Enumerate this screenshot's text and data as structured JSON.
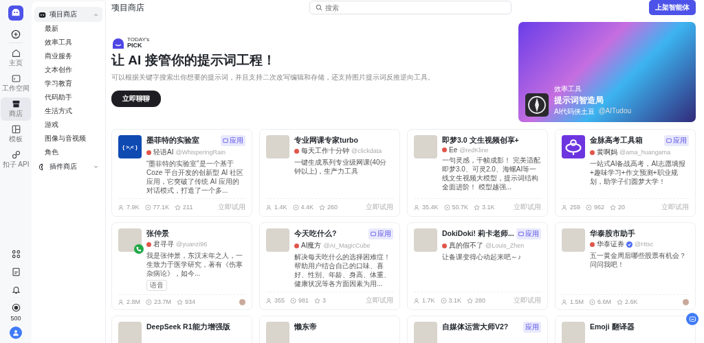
{
  "rail": {
    "items": [
      {
        "label": "主页",
        "selected": false
      },
      {
        "label": "工作空间",
        "selected": false
      },
      {
        "label": "商店",
        "selected": true
      },
      {
        "label": "模板",
        "selected": false
      },
      {
        "label": "扣子 API",
        "selected": false
      }
    ],
    "credits": "500"
  },
  "sidebar": {
    "groups": [
      {
        "label": "项目商店",
        "expanded": true,
        "selected": true,
        "items": [
          "最新",
          "效率工具",
          "商业服务",
          "文本创作",
          "学习教育",
          "代码助手",
          "生活方式",
          "游戏",
          "图像与音视频",
          "角色"
        ]
      },
      {
        "label": "插件商店",
        "expanded": false,
        "selected": false
      }
    ]
  },
  "header": {
    "title": "项目商店",
    "search": {
      "placeholder": "搜索"
    },
    "publish_button": "上架智能体"
  },
  "hero": {
    "pick_badge": [
      "TODAY's",
      "PICK"
    ],
    "headline": "让 AI 接管你的提示词工程！",
    "subtitle": "可以根据关键字搜索出你想要的提示词，并且支持二次改写编辑和存储，还支持图片提示词反推逆向工具。",
    "cta": "立即聊聊",
    "feature": {
      "category": "效率工具",
      "title": "提示词智造局",
      "author": "AI代码侠土豆",
      "handle": "@AITudou"
    }
  },
  "cards": [
    {
      "title": "墨菲特的实验室",
      "badge": "应用",
      "avatar": {
        "kind": "code",
        "text": "{ >,< }"
      },
      "author": "轻语AI",
      "handle": "@WhisperingRain",
      "description": "“墨菲特的实验室”是一个基于 Coze 平台开发的创新型 AI 社区应用，它突破了传统 AI 应用的对话模式，打造了一个多...",
      "users": "7.9K",
      "chats": "77.1K",
      "stars": "211",
      "action": "立即试用"
    },
    {
      "title": "专业网课专家turbo",
      "avatar": {
        "kind": "photo"
      },
      "author": "每天工作十分钟",
      "handle": "@clickdata",
      "description": "一键生成系列专业级网课(40分钟以上)，生产力工具",
      "users": "1.4K",
      "chats": "4.4K",
      "stars": "260",
      "action": "立即试用"
    },
    {
      "title": "即梦3.0 文生视频创享+",
      "avatar": {
        "kind": "photo"
      },
      "author": "Ee",
      "handle": "@redKline",
      "description": "一句灵感，千帧成影！ 完美适配即梦3.0、可灵2.0、海螺AI等一线文生视频大模型，提示词结构全面进阶！ 模型越强...",
      "users": "35.4K",
      "chats": "50.7K",
      "stars": "3.1K",
      "action": "立即试用"
    },
    {
      "title": "金脉高考工具箱",
      "badge": "应用",
      "avatar": {
        "kind": "emblem"
      },
      "author": "黄啊妈",
      "handle": "@ama_huangama",
      "description": "一站式AI备战高考，AI志愿填报+趣味学习+作文预测+职业规划，助学子们圆梦大学！",
      "users": "259",
      "chats": "962",
      "stars": "20",
      "action": "立即试用"
    },
    {
      "title": "张仲景",
      "avatar": {
        "kind": "photo",
        "call": true
      },
      "author": "君寻寻",
      "handle": "@yuanzi96",
      "description": "我是张仲景，东汉末年之人，一生致力于医学研究，著有《伤寒杂病论》，如今...",
      "tag": "语音",
      "users": "2.8M",
      "chats": "23.7M",
      "stars": "934"
    },
    {
      "title": "今天吃什么?",
      "badge": "应用",
      "avatar": {
        "kind": "photo"
      },
      "author": "AI魔方",
      "handle": "@AI_MagicCube",
      "description": "解决每天吃什么的选择困难症！帮助用户结合自己的口味、喜好、性别、年龄、身高、体重、健康状况等各方面因素为用...",
      "users": "355",
      "chats": "981",
      "stars": "3",
      "action": "立即试用"
    },
    {
      "title": "DokiDoki! 莉卡老师...",
      "badge": "应用",
      "avatar": {
        "kind": "photo"
      },
      "author": "真的假不了",
      "handle": "@Louis_Zhen",
      "description": "让备课变得心动起来吧～♪",
      "users": "1.7K",
      "chats": "3.1K",
      "stars": "280",
      "action": "立即试用"
    },
    {
      "title": "华泰股市助手",
      "avatar": {
        "kind": "photo"
      },
      "author": "华泰证券",
      "handle": "@Htsc",
      "verified": true,
      "description": "五一黄金周后哪些股票有机会？问问我吧！",
      "users": "1.5M",
      "chats": "6.6M",
      "stars": "2.6K"
    }
  ],
  "more_cards": [
    {
      "title": "DeepSeek R1能力增强版"
    },
    {
      "title": "懒东帝"
    },
    {
      "title": "自媒体运营大师V2?",
      "badge": "应用"
    },
    {
      "title": "Emoji 翻译器"
    }
  ]
}
